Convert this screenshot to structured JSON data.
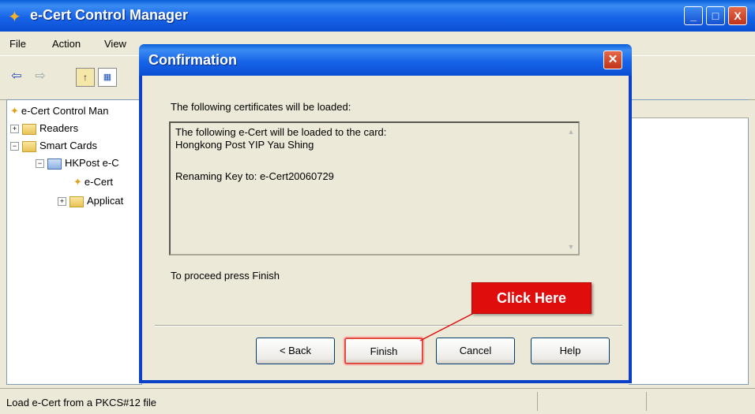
{
  "window": {
    "title": "e-Cert Control Manager",
    "controls": {
      "minimize": "_",
      "maximize": "□",
      "close": "X"
    }
  },
  "menu": {
    "items": [
      "File",
      "Action",
      "View"
    ]
  },
  "tree": {
    "root": "e-Cert Control Man",
    "readers": "Readers",
    "smart_cards": "Smart Cards",
    "hkpost": "HKPost e-C",
    "ecert": "e-Cert",
    "applications": "Applicat"
  },
  "status": {
    "text": "Load e-Cert from a PKCS#12 file"
  },
  "dialog": {
    "title": "Confirmation",
    "intro": "The following certificates will be loaded:",
    "content_lines": [
      "The following e-Cert will be loaded to the card:",
      "Hongkong Post YIP Yau Shing",
      "",
      "Renaming Key to: e-Cert20060729"
    ],
    "proceed": "To proceed press Finish",
    "buttons": {
      "back": "< Back",
      "finish": "Finish",
      "cancel": "Cancel",
      "help": "Help"
    }
  },
  "annotation": {
    "label": "Click Here",
    "color": "#e00d0d"
  }
}
